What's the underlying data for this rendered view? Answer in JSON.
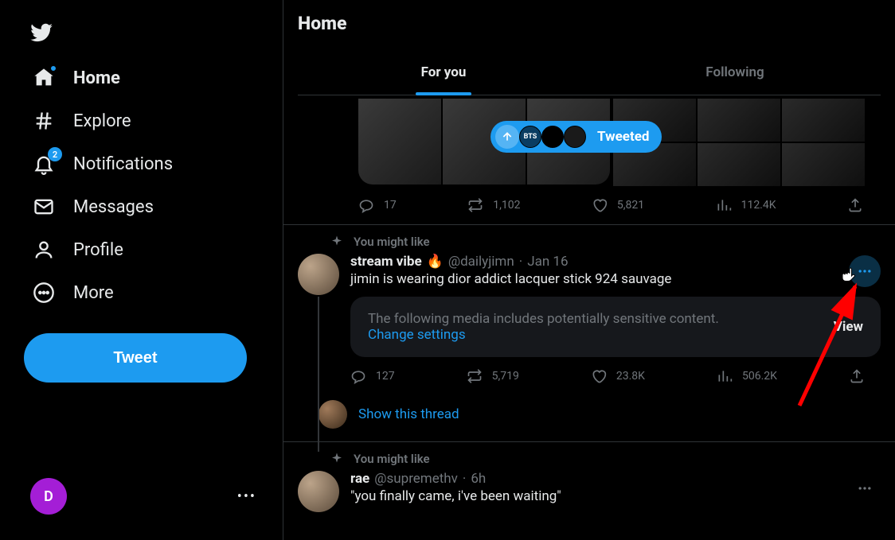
{
  "sidebar": {
    "home": "Home",
    "explore": "Explore",
    "notifications": "Notifications",
    "notifications_badge": "2",
    "messages": "Messages",
    "profile": "Profile",
    "more": "More",
    "tweet": "Tweet",
    "account_initial": "D"
  },
  "header": {
    "title": "Home",
    "tab_foryou": "For you",
    "tab_following": "Following"
  },
  "tweet0": {
    "pill_label": "Tweeted",
    "pill_av1": "BTS",
    "replies": "17",
    "retweets": "1,102",
    "likes": "5,821",
    "views": "112.4K"
  },
  "tweet1": {
    "context": "You might like",
    "name": "stream vibe",
    "emoji": "🔥",
    "handle": "@dailyjimn",
    "sep": "·",
    "time": "Jan 16",
    "text": "jimin is wearing dior addict lacquer stick 924 sauvage",
    "sensitive_msg": "The following media includes potentially sensitive content.",
    "change_settings": "Change settings",
    "view": "View",
    "replies": "127",
    "retweets": "5,719",
    "likes": "23.8K",
    "views": "506.2K",
    "show_thread": "Show this thread"
  },
  "tweet2": {
    "context": "You might like",
    "name": "rae",
    "handle": "@supremethv",
    "sep": "·",
    "time": "6h",
    "text": "\"you finally came, i've been waiting\""
  }
}
